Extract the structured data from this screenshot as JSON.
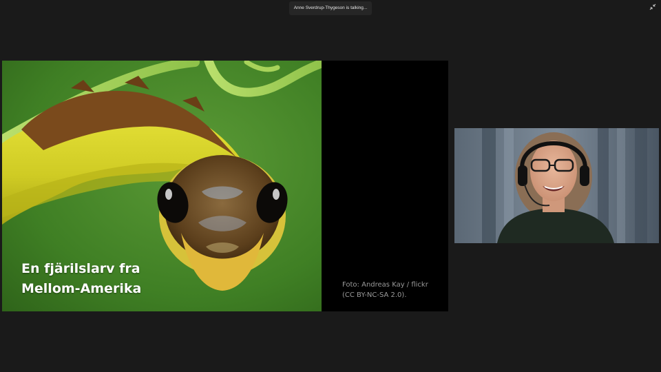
{
  "meeting": {
    "talking_indicator": "Anne Sverdrup-Thygeson is talking...",
    "exit_fullscreen_icon": "collapse-arrows-icon"
  },
  "shared_slide": {
    "caption_line1": "En fjärilslarv fra",
    "caption_line2": "Mellom-Amerika",
    "credit_line1": "Foto: Andreas Kay / flickr",
    "credit_line2": "(CC BY-NC-SA 2.0)."
  },
  "colors": {
    "background": "#1a1a1a",
    "slide_background": "#000000",
    "photo_green": "#3f7f24",
    "larva_yellow": "#d8d62a",
    "larva_brown": "#7a4a1c"
  }
}
